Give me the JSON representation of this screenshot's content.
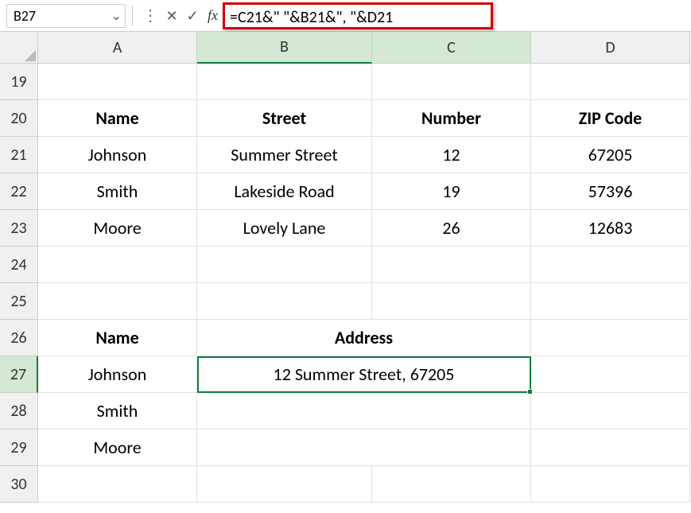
{
  "nameBox": "B27",
  "formula": "=C21&\" \"&B21&\", \"&D21",
  "columns": [
    "A",
    "B",
    "C",
    "D"
  ],
  "rowNumbers": [
    "19",
    "20",
    "21",
    "22",
    "23",
    "24",
    "25",
    "26",
    "27",
    "28",
    "29",
    "30"
  ],
  "headers1": {
    "a": "Name",
    "b": "Street",
    "c": "Number",
    "d": "ZIP Code"
  },
  "data1": {
    "r21": {
      "a": "Johnson",
      "b": "Summer Street",
      "c": "12",
      "d": "67205"
    },
    "r22": {
      "a": "Smith",
      "b": "Lakeside Road",
      "c": "19",
      "d": "57396"
    },
    "r23": {
      "a": "Moore",
      "b": "Lovely Lane",
      "c": "26",
      "d": "12683"
    }
  },
  "headers2": {
    "a": "Name",
    "bc": "Address"
  },
  "data2": {
    "r27": {
      "a": "Johnson",
      "bc": "12 Summer Street, 67205"
    },
    "r28": {
      "a": "Smith"
    },
    "r29": {
      "a": "Moore"
    }
  },
  "activeCell": "B27",
  "chart_data": {
    "type": "table",
    "tables": [
      {
        "title": "Table 1",
        "columns": [
          "Name",
          "Street",
          "Number",
          "ZIP Code"
        ],
        "rows": [
          [
            "Johnson",
            "Summer Street",
            12,
            67205
          ],
          [
            "Smith",
            "Lakeside Road",
            19,
            57396
          ],
          [
            "Moore",
            "Lovely Lane",
            26,
            12683
          ]
        ]
      },
      {
        "title": "Table 2",
        "columns": [
          "Name",
          "Address"
        ],
        "rows": [
          [
            "Johnson",
            "12 Summer Street, 67205"
          ],
          [
            "Smith",
            ""
          ],
          [
            "Moore",
            ""
          ]
        ]
      }
    ]
  }
}
